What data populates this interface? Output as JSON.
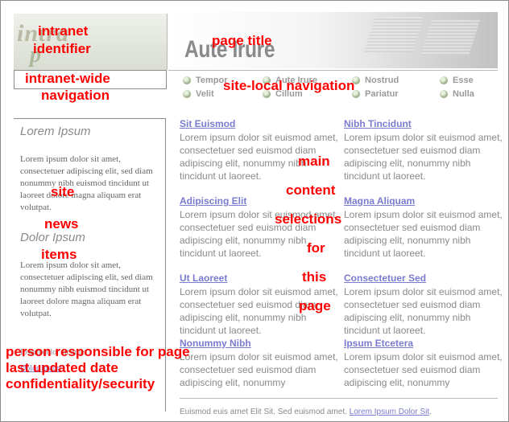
{
  "logo": {
    "word_a": "intra",
    "word_b": "p"
  },
  "header": {
    "page_title": "Aute Irure"
  },
  "local_nav": {
    "items": [
      {
        "label": "Tempor"
      },
      {
        "label": "Aute Irure"
      },
      {
        "label": "Nostrud"
      },
      {
        "label": "Esse"
      },
      {
        "label": "Velit"
      },
      {
        "label": "Cillum"
      },
      {
        "label": "Pariatur"
      },
      {
        "label": "Nulla"
      }
    ]
  },
  "news": [
    {
      "heading": "Lorem Ipsum",
      "body": "Lorem ipsum dolor sit amet, consectetuer adipiscing elit, sed diam nonummy nibh euismod tincidunt ut laoreet dolore magna aliquam erat volutpat."
    },
    {
      "heading": "Dolor Ipsum",
      "body": "Lorem ipsum dolor sit amet, consectetuer adipiscing elit, sed diam nonummy nibh euismod tincidunt ut laoreet dolore magna aliquam erat volutpat."
    }
  ],
  "left_footer": {
    "line1": "Ipsum dolor sit amet",
    "line2": "Dolor Ipsum"
  },
  "sections": [
    {
      "title": "Sit Euismod",
      "body": "Lorem ipsum dolor sit euismod amet, consectetuer sed euismod diam adipiscing elit, nonummy nibh tincidunt ut laoreet."
    },
    {
      "title": "Nibh Tincidunt",
      "body": "Lorem ipsum dolor sit euismod amet, consectetuer sed euismod diam adipiscing elit, nonummy nibh tincidunt ut laoreet."
    },
    {
      "title": "Adipiscing Elit",
      "body": "Lorem ipsum dolor sit euismod amet, consectetuer sed euismod diam adipiscing elit, nonummy nibh tincidunt ut laoreet."
    },
    {
      "title": "Magna Aliquam",
      "body": "Lorem ipsum dolor sit euismod amet, consectetuer sed euismod diam adipiscing elit, nonummy nibh tincidunt ut laoreet."
    },
    {
      "title": "Ut Laoreet",
      "body": "Lorem ipsum dolor sit euismod amet, consectetuer sed euismod diam adipiscing elit, nonummy nibh tincidunt ut laoreet."
    },
    {
      "title": "Consectetuer Sed",
      "body": "Lorem ipsum dolor sit euismod amet, consectetuer sed euismod diam adipiscing elit, nonummy nibh tincidunt ut laoreet."
    },
    {
      "title": "Nonummy Nibh",
      "body": "Lorem ipsum dolor sit euismod amet, consectetuer sed euismod diam adipiscing elit, nonummy"
    },
    {
      "title": "Ipsum Etcetera",
      "body": "Lorem ipsum dolor sit euismod amet, consectetuer sed euismod diam adipiscing elit, nonummy"
    }
  ],
  "footer": {
    "text": "Euismod euis amet Elit Sit. Sed euismod amet.",
    "link": "Lorem Ipsum Dolor Sit",
    "end": "."
  },
  "annotations": {
    "intranet_identifier": [
      "intranet",
      "identifier"
    ],
    "intranet_wide_navigation": [
      "intranet-wide",
      "navigation"
    ],
    "page_title": "page title",
    "site_local_navigation": "site-local navigation",
    "site_news_items": [
      "site",
      "news",
      "items"
    ],
    "main_content": [
      "main",
      "content",
      "selections",
      "for",
      "this",
      "page"
    ],
    "footer_notes": [
      "person responsible for page",
      "last updated date",
      "confidentiality/security"
    ]
  },
  "colors": {
    "link": "#7b7bd0",
    "annotation": "#ff0000",
    "text_gray": "#8a8a8a"
  }
}
